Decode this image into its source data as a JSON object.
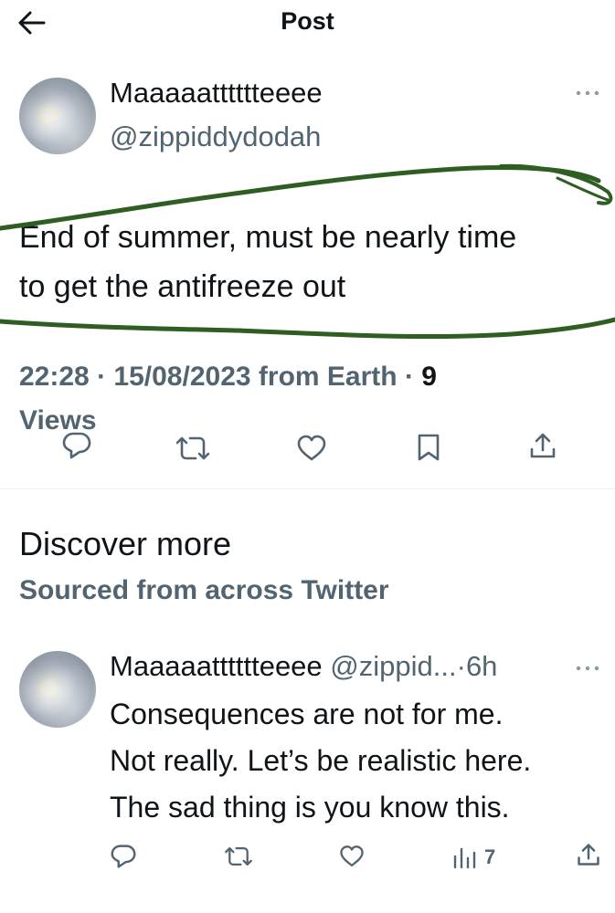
{
  "header": {
    "title": "Post"
  },
  "post": {
    "display_name": "Maaaaatttttteeee",
    "handle": "@zippiddydodah",
    "text_line1": "End of summer, must be nearly time",
    "text_line2": "to get the antifreeze out",
    "time": "22:28",
    "date": "15/08/2023",
    "source": "from Earth",
    "views_count": "9",
    "views_label": "Views",
    "separator": "·"
  },
  "discover": {
    "title": "Discover more",
    "subtitle": "Sourced from across Twitter"
  },
  "tweet2": {
    "display_name": "Maaaaatttttteeee",
    "handle_truncated": "@zippid...",
    "separator": "·",
    "time": "6h",
    "line1": "Consequences are not for me.",
    "line2": "Not really. Let’s be realistic here.",
    "line3": "The sad thing is you know this.",
    "views_count": "7"
  },
  "colors": {
    "annotation": "#2f5e23",
    "secondary_text": "#536471",
    "primary_text": "#0f1419"
  },
  "icons": {
    "back": "arrow-left-icon",
    "more": "more-icon",
    "reply": "reply-icon",
    "retweet": "retweet-icon",
    "like": "heart-icon",
    "bookmark": "bookmark-icon",
    "share": "share-icon",
    "views": "views-chart-icon"
  }
}
